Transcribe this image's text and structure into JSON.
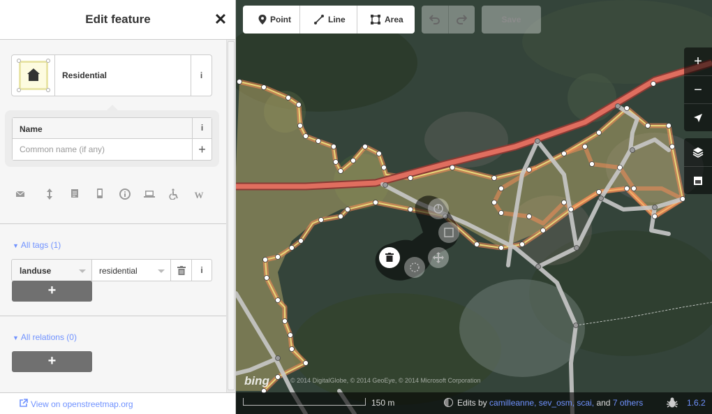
{
  "sidebar": {
    "title": "Edit feature",
    "close_label": "✕",
    "preset": {
      "name": "Residential",
      "info_label": "i"
    },
    "name_field": {
      "label": "Name",
      "info_label": "i",
      "placeholder": "Common name (if any)",
      "add_label": "+"
    },
    "field_icons": [
      "email-icon",
      "elevation-icon",
      "note-icon",
      "phone-icon",
      "address-icon",
      "website-icon",
      "wheelchair-icon",
      "wikipedia-icon"
    ],
    "all_tags": {
      "label": "All tags (1)",
      "tags": [
        {
          "key": "landuse",
          "value": "residential"
        }
      ],
      "info_label": "i",
      "add_label": "+"
    },
    "all_relations": {
      "label": "All relations (0)",
      "add_label": "+"
    },
    "footer_link": "View on openstreetmap.org"
  },
  "toolbar": {
    "point_label": "Point",
    "line_label": "Line",
    "area_label": "Area",
    "save_label": "Save"
  },
  "map_controls": {
    "zoom_in": "+",
    "zoom_out": "−"
  },
  "map": {
    "imagery_logo": "bing",
    "attribution": "© 2014 DigitalGlobe, © 2014 GeoEye, © 2014 Microsoft Corporation",
    "scale_label": "150 m",
    "edits_prefix": "Edits by",
    "edits_users": "camilleanne, sev_osm, scai,",
    "edits_and": "and",
    "edits_others": "7 others",
    "version": "1.6.2"
  },
  "colors": {
    "accent": "#7092ff",
    "area_fill": "#e8d77a",
    "road_primary": "#e06e5f",
    "selected_halo": "#ff8e57"
  }
}
